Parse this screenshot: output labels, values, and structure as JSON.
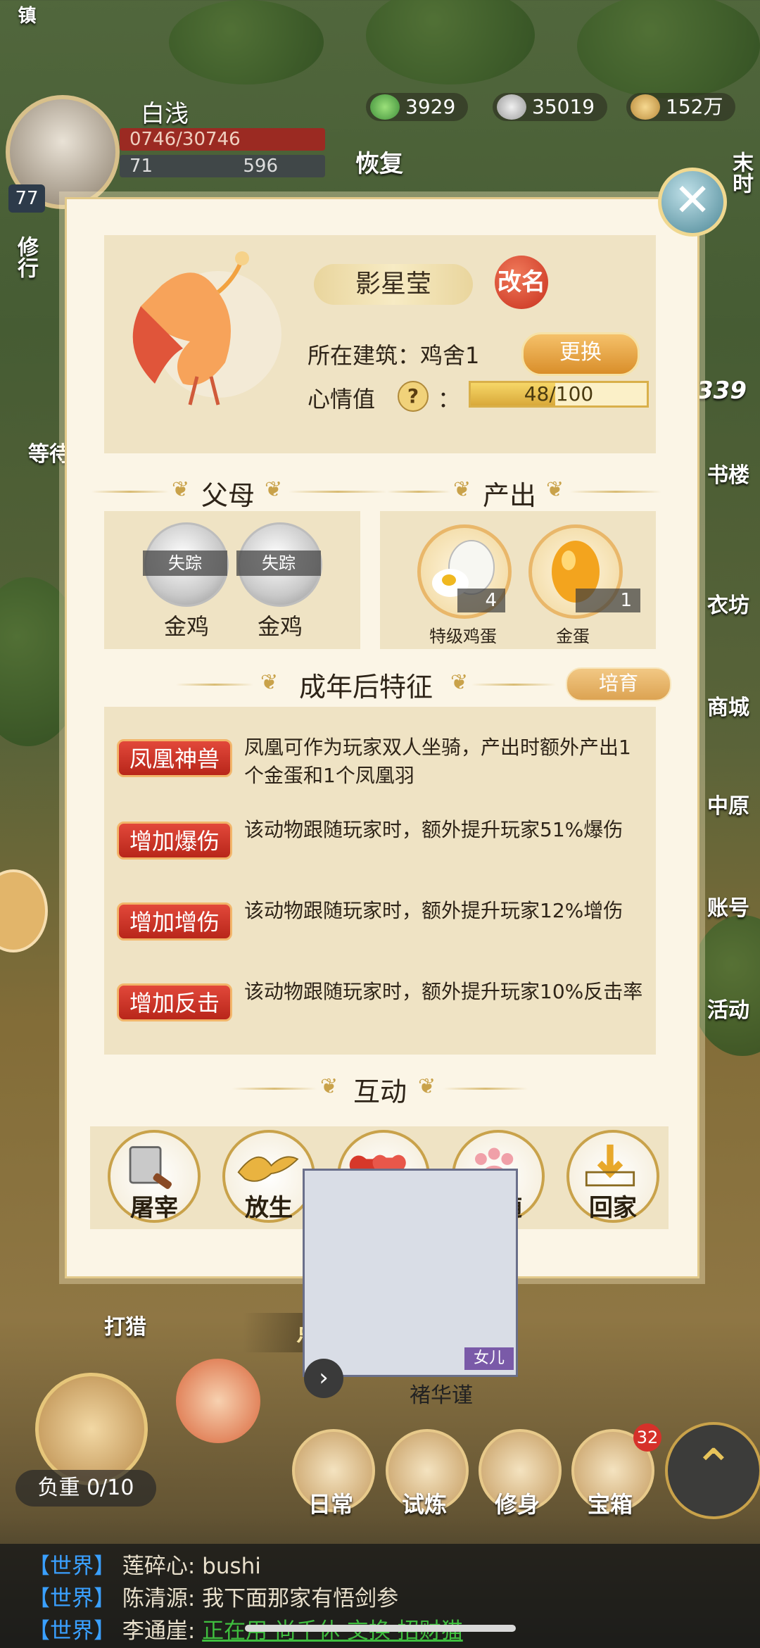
{
  "hud": {
    "town_char": "镇",
    "player_name": "白浅",
    "hp_text": "0746/30746",
    "mp_left": "71",
    "mp_right": "596",
    "level": "77",
    "currency_1": "3929",
    "currency_2": "35019",
    "currency_3": "152万",
    "recover_label": "恢复",
    "right_time_label": "末时",
    "left_side_label": "修行",
    "left_wait_label": "等待",
    "right_number": "339",
    "right_menu": [
      "书楼",
      "衣坊",
      "商城",
      "中原",
      "账号",
      "活动"
    ]
  },
  "modal": {
    "pet_name": "影星莹",
    "rename_label": "改名",
    "building_label": "所在建筑：鸡舍1",
    "swap_label": "更换",
    "mood_label": "心情值",
    "mood_help": "?",
    "mood_colon": "：",
    "mood_text": "48/100",
    "mood_fraction": 0.48,
    "parents_title": "父母",
    "parents": [
      {
        "status": "失踪",
        "name": "金鸡"
      },
      {
        "status": "失踪",
        "name": "金鸡"
      }
    ],
    "output_title": "产出",
    "outputs": [
      {
        "name": "特级鸡蛋",
        "count": "4"
      },
      {
        "name": "金蛋",
        "count": "1"
      }
    ],
    "traits_title": "成年后特征",
    "breed_label": "培育",
    "traits": [
      {
        "tag": "凤凰神兽",
        "desc": "凤凰可作为玩家双人坐骑，产出时额外产出1个金蛋和1个凤凰羽"
      },
      {
        "tag": "增加爆伤",
        "desc": "该动物跟随玩家时，额外提升玩家51%爆伤"
      },
      {
        "tag": "增加增伤",
        "desc": "该动物跟随玩家时，额外提升玩家12%增伤"
      },
      {
        "tag": "增加反击",
        "desc": "该动物跟随玩家时，额外提升玩家10%反击率"
      }
    ],
    "interact_title": "互动",
    "actions": [
      {
        "label": "屠宰",
        "icon": "cleaver-icon"
      },
      {
        "label": "放生",
        "icon": "bird-release-icon"
      },
      {
        "label": "繁育",
        "icon": "hearts-icon"
      },
      {
        "label": "跟随",
        "icon": "paw-icon"
      },
      {
        "label": "回家",
        "icon": "home-arrow-icon"
      }
    ]
  },
  "hint": "点击空白处关闭",
  "bottom": {
    "hunt_label": "打猎",
    "npc_name": "褚华谨",
    "npc_tag": "女儿",
    "load_label": "负重 0/10",
    "nav": [
      {
        "label": "日常"
      },
      {
        "label": "试炼"
      },
      {
        "label": "修身"
      },
      {
        "label": "宝箱",
        "badge": "32"
      }
    ]
  },
  "chat": [
    {
      "channel": "【世界】",
      "text": "莲碎心: bushi"
    },
    {
      "channel": "【世界】",
      "text": "陈清源: 我下面那家有悟剑参"
    },
    {
      "channel": "【世界】",
      "text": "李通崖: ",
      "link": "正在用  尚千休  交换  招财猫"
    }
  ]
}
